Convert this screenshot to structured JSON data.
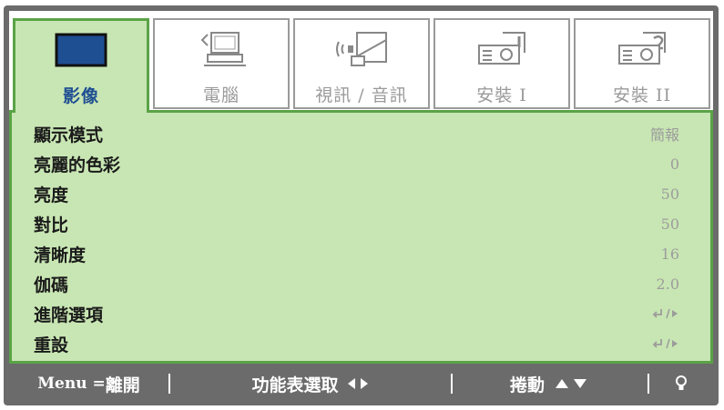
{
  "tabs": [
    {
      "label": "影像",
      "icon": "monitor-icon",
      "active": true
    },
    {
      "label": "電腦",
      "icon": "computer-icon",
      "active": false
    },
    {
      "label": "視訊 / 音訊",
      "icon": "video-audio-icon",
      "active": false
    },
    {
      "label": "安裝 I",
      "icon": "projector-setup-1-icon",
      "active": false
    },
    {
      "label": "安裝 II",
      "icon": "projector-setup-2-icon",
      "active": false
    }
  ],
  "settings": [
    {
      "label": "顯示模式",
      "value": "簡報"
    },
    {
      "label": "亮麗的色彩",
      "value": "0"
    },
    {
      "label": "亮度",
      "value": "50"
    },
    {
      "label": "對比",
      "value": "50"
    },
    {
      "label": "清晰度",
      "value": "16"
    },
    {
      "label": "伽碼",
      "value": "2.0"
    },
    {
      "label": "進階選項",
      "value": ""
    },
    {
      "label": "重設",
      "value": ""
    }
  ],
  "statusbar": {
    "menu_key": "Menu = ",
    "menu_action": "離開",
    "select": "功能表選取",
    "scroll": "捲動"
  },
  "colors": {
    "panel_bg": "#c8e6b3",
    "panel_border": "#5aa347",
    "active_tab_text": "#1f4f93",
    "frame": "#6b6b6b"
  }
}
